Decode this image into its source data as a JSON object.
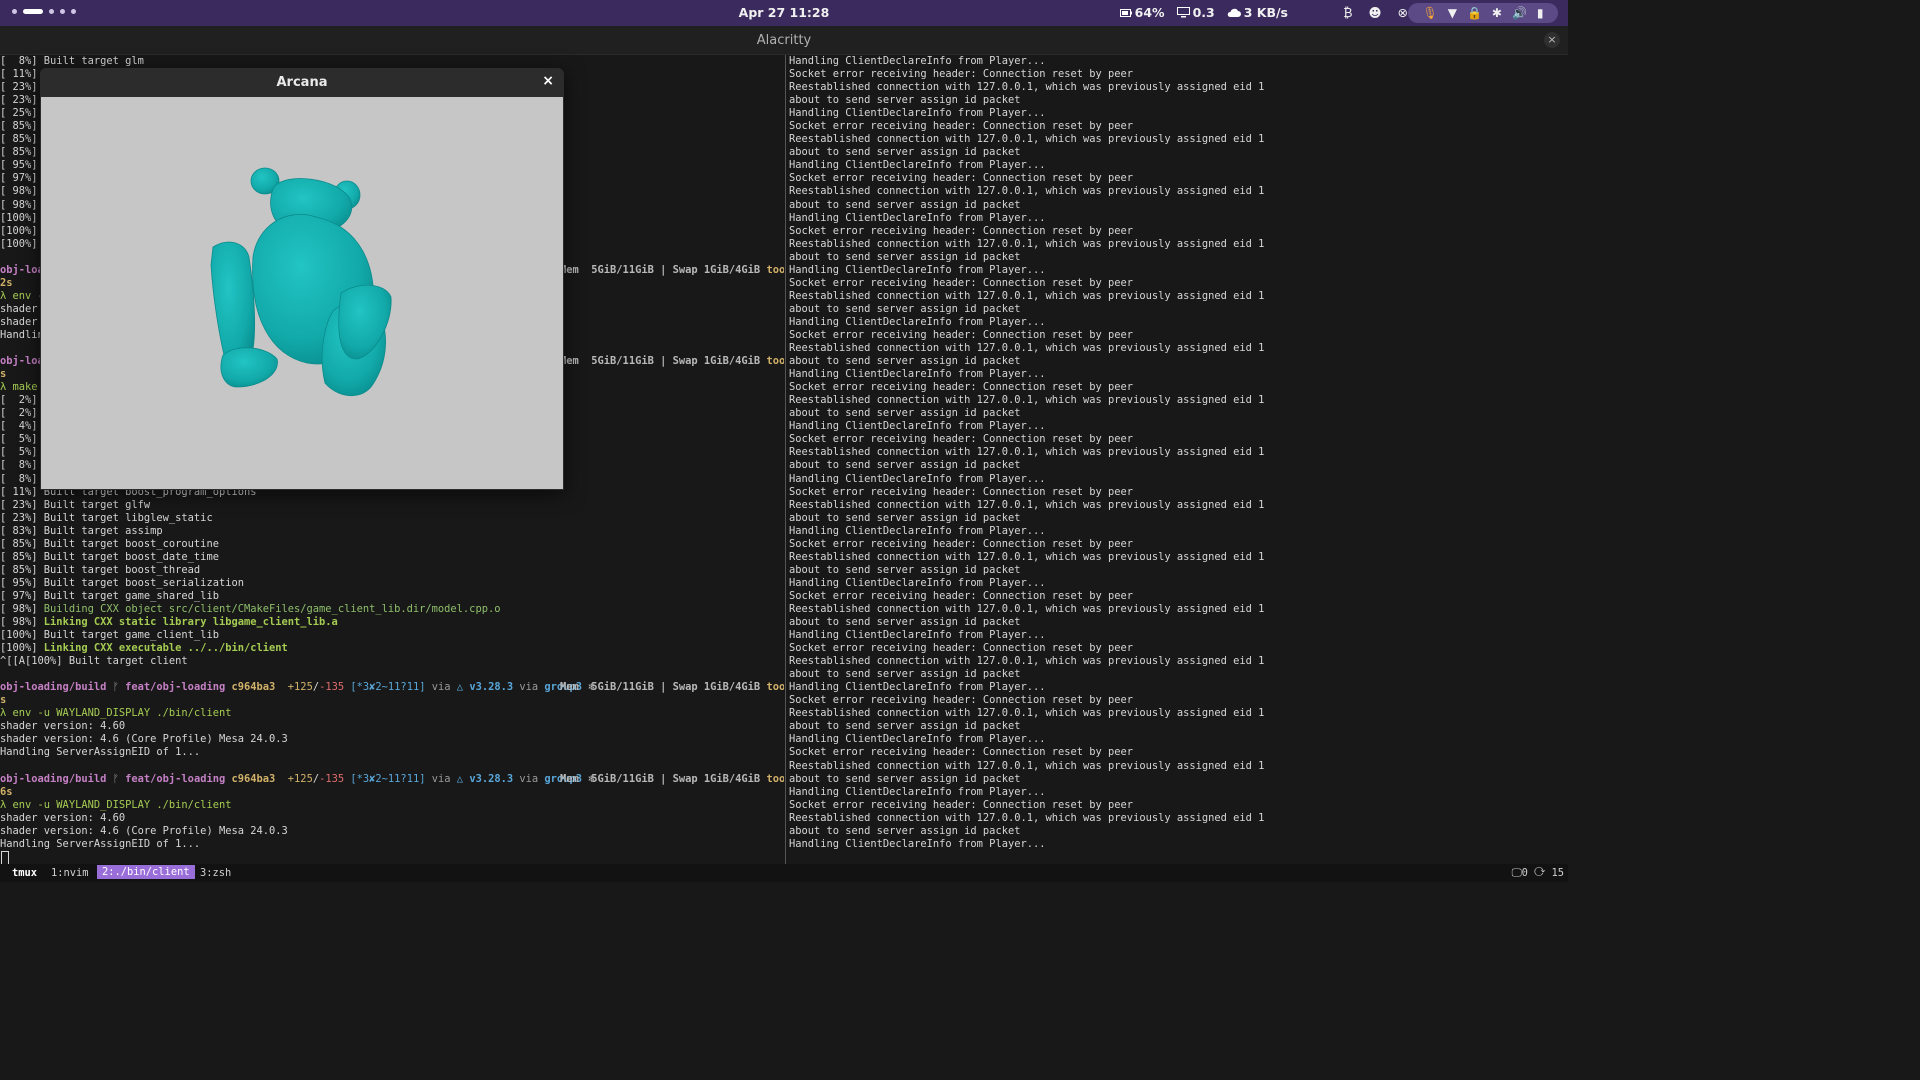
{
  "topbar": {
    "clock": "Apr 27  11:28",
    "stats": [
      {
        "icon": "battery-icon",
        "text": "64%"
      },
      {
        "icon": "monitor-icon",
        "text": "0.3"
      },
      {
        "icon": "cloud-icon",
        "text": "3 KB/s"
      }
    ],
    "tray_icons": [
      "bluetooth-icon",
      "discord-icon",
      "xbox-icon"
    ],
    "status_icons": [
      "microphone-icon",
      "wifi-icon",
      "lock-icon",
      "bluetooth-icon",
      "volume-icon",
      "battery-icon"
    ],
    "accent": "#3a2a5e"
  },
  "window": {
    "title": "Alacritty",
    "close_label": "×"
  },
  "arcana": {
    "title": "Arcana",
    "close_label": "×",
    "model_color": "#16b3b3",
    "bg_color": "#c6c6c6"
  },
  "prompt": {
    "path": "obj-loading/build",
    "branch": "feat/obj-loading",
    "hash": "c964ba3",
    "add": "+125",
    "del": "-135",
    "status": "[*3✘2~11?11]",
    "via1": "via",
    "ver": "v3.28.3",
    "via2": "via",
    "group": "group3",
    "mem": "Mem  5GiB/11GiB | Swap 1GiB/4GiB",
    "took": "took"
  },
  "left": {
    "build1": [
      "[  8%] Built target glm",
      "[ 11%]",
      "[ 23%]",
      "[ 23%]",
      "[ 25%]",
      "[ 85%]",
      "[ 85%]",
      "[ 85%]",
      "[ 95%]",
      "[ 97%]",
      "[ 98%]",
      "[ 98%]",
      "[100%]",
      "[100%]",
      "[100%]"
    ],
    "p1_tail": "obj-loa",
    "p1_time": "2s",
    "run1": [
      "λ env -",
      "shader",
      "shader",
      "Handlin"
    ],
    "p2_tail": "obj-loa",
    "p2_time": "s",
    "make_cmd": "λ make",
    "build2_hidden": [
      "[  2%]",
      "[  2%]",
      "[  4%]",
      "[  5%]",
      "[  5%]",
      "[  8%]",
      "[  8%]"
    ],
    "build2_visible": [
      "[ 11%] Built target boost_program_options",
      "[ 23%] Built target glfw",
      "[ 23%] Built target libglew_static",
      "[ 83%] Built target assimp",
      "[ 85%] Built target boost_coroutine",
      "[ 85%] Built target boost_date_time",
      "[ 85%] Built target boost_thread",
      "[ 95%] Built target boost_serialization",
      "[ 97%] Built target game_shared_lib"
    ],
    "building_pct": "[ 98%] ",
    "building_text": "Building CXX object src/client/CMakeFiles/game_client_lib.dir/model.cpp.o",
    "linking1_pct": "[ 98%] ",
    "linking1_text": "Linking CXX static library libgame_client_lib.a",
    "built_client_lib": "[100%] Built target game_client_lib",
    "linking2_pct": "[100%] ",
    "linking2_text": "Linking CXX executable ../../bin/client",
    "built_client": "^[[A[100%] Built target client",
    "p3_time": "s",
    "run2": [
      "λ env -u WAYLAND_DISPLAY ./bin/client",
      "shader version: 4.60",
      "shader version: 4.6 (Core Profile) Mesa 24.0.3",
      "Handling ServerAssignEID of 1..."
    ],
    "p4_time": "6s",
    "run3": [
      "λ env -u WAYLAND_DISPLAY ./bin/client",
      "shader version: 4.60",
      "shader version: 4.6 (Core Profile) Mesa 24.0.3",
      "Handling ServerAssignEID of 1..."
    ]
  },
  "right": {
    "first_line": "Handling ClientDeclareInfo from Player...",
    "cycle": [
      "Socket error receiving header: Connection reset by peer",
      "Reestablished connection with 127.0.0.1, which was previously assigned eid 1",
      "about to send server assign id packet",
      "Handling ClientDeclareInfo from Player..."
    ],
    "cycles": 15
  },
  "tmux": {
    "session": "tmux",
    "windows": [
      "1:nvim",
      "2:./bin/client",
      "3:zsh"
    ],
    "active_index": 1,
    "right_status": "🖵0 ⟳ 15"
  }
}
